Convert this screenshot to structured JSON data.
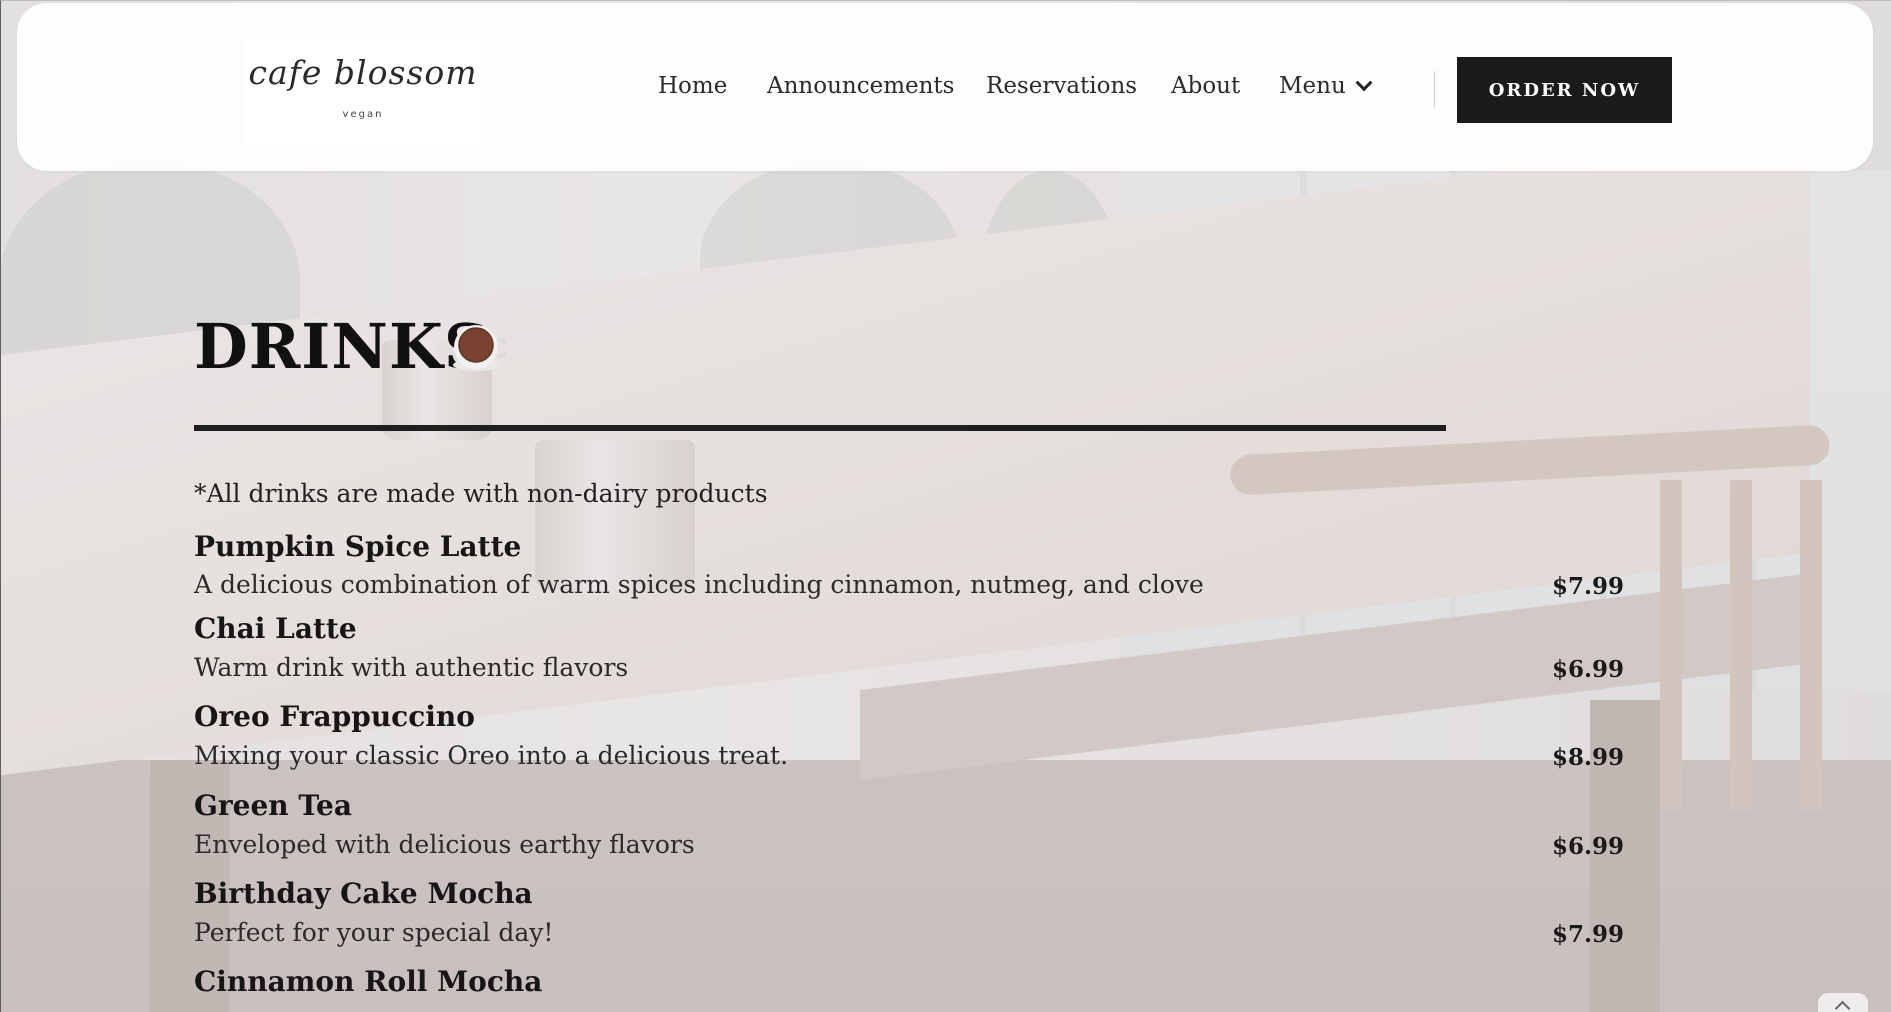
{
  "header": {
    "logo_text": "cafe blossom",
    "logo_sub": "vegan",
    "nav": {
      "home": "Home",
      "announcements": "Announcements",
      "reservations": "Reservations",
      "about": "About",
      "menu": "Menu"
    },
    "order_button": "ORDER NOW"
  },
  "section": {
    "title": "DRINKS",
    "icon": "coffee-cup-icon",
    "note": "*All drinks are made with non-dairy products"
  },
  "items": [
    {
      "name": "Pumpkin Spice Latte",
      "description": "A delicious combination of warm spices including cinnamon, nutmeg, and clove",
      "price": "$7.99"
    },
    {
      "name": "Chai Latte",
      "description": "Warm drink with authentic flavors",
      "price": "$6.99"
    },
    {
      "name": "Oreo Frappuccino",
      "description": "Mixing your classic Oreo into a delicious treat.",
      "price": "$8.99"
    },
    {
      "name": "Green Tea",
      "description": "Enveloped with delicious earthy flavors",
      "price": "$6.99"
    },
    {
      "name": "Birthday Cake Mocha",
      "description": "Perfect for your special day!",
      "price": "$7.99"
    },
    {
      "name": "Cinnamon Roll Mocha"
    }
  ],
  "colors": {
    "button_bg": "#1b1b1e",
    "text": "#1c1b1d",
    "header_bg": "#ffffff"
  }
}
